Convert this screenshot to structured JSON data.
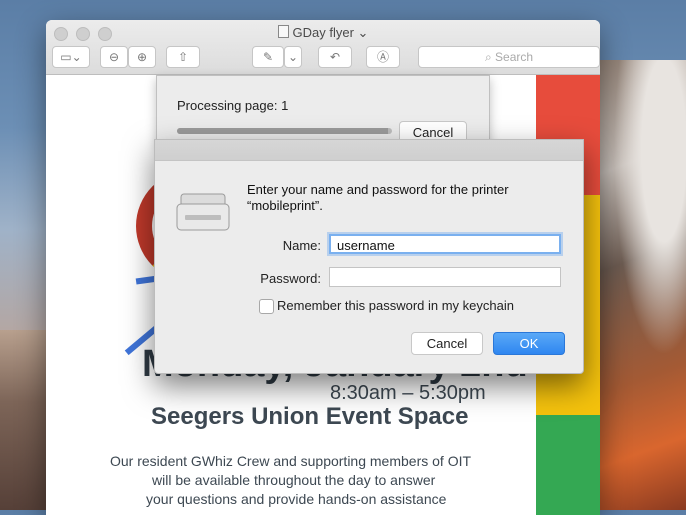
{
  "window": {
    "title": "GDay flyer ⌄"
  },
  "toolbar": {
    "search_placeholder": "Search"
  },
  "document": {
    "line1": "Monday, January 2nd",
    "time": "8:30am – 5:30pm",
    "venue": "Seegers Union Event Space",
    "body1": "Our resident GWhiz Crew and supporting members of OIT",
    "body2": "will be available throughout the day to answer",
    "body3": "your questions and provide hands-on assistance",
    "stripe_colors": [
      "#e74c3c",
      "#f1c40f",
      "#34a853"
    ]
  },
  "processing": {
    "label": "Processing page: 1",
    "cancel_label": "Cancel",
    "progress": 0.98
  },
  "dialog": {
    "message": "Enter your name and password for the printer “mobileprint”.",
    "name_label": "Name:",
    "name_value": "username",
    "password_label": "Password:",
    "password_value": "",
    "remember_label": "Remember this password in my keychain",
    "remember_checked": false,
    "cancel_label": "Cancel",
    "ok_label": "OK"
  }
}
